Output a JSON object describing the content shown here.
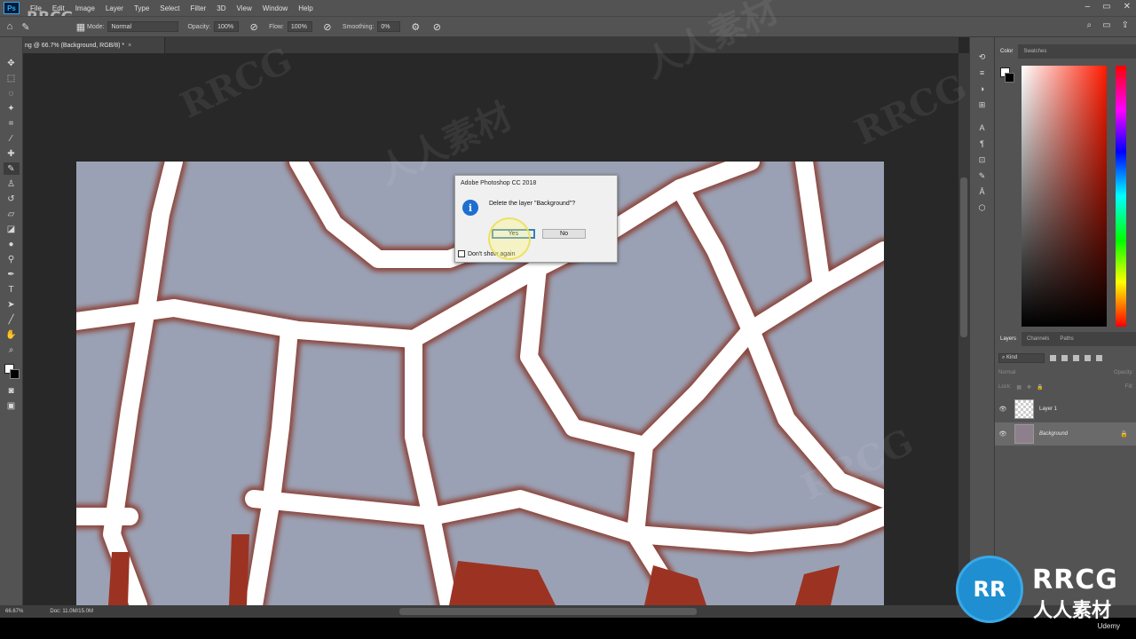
{
  "app": {
    "logo_text": "Ps",
    "menu": [
      "File",
      "Edit",
      "Image",
      "Layer",
      "Type",
      "Select",
      "Filter",
      "3D",
      "View",
      "Window",
      "Help"
    ],
    "window_controls": [
      "–",
      "▭",
      "✕"
    ]
  },
  "options_bar": {
    "mode_label": "Mode:",
    "mode_value": "Normal",
    "opacity_label": "Opacity:",
    "opacity_value": "100%",
    "flow_label": "Flow:",
    "flow_value": "100%",
    "smoothing_label": "Smoothing:",
    "smoothing_value": "0%"
  },
  "document": {
    "tab_title": "ng @ 66.7% (Background, RGB/8) *",
    "close_glyph": "×"
  },
  "dialog": {
    "title": "Adobe Photoshop CC 2018",
    "info_glyph": "i",
    "message": "Delete the layer \"Background\"?",
    "yes_label": "Yes",
    "no_label": "No",
    "dont_show_label": "Don't show again"
  },
  "color_panel": {
    "tabs": [
      "Color",
      "Swatches"
    ],
    "foreground_color": "#ffffff",
    "background_color": "#000000"
  },
  "layers_panel": {
    "tabs": [
      "Layers",
      "Channels",
      "Paths"
    ],
    "kind_label": "Kind",
    "blend_mode": "Normal",
    "opacity_text": "Opacity:",
    "lock_label": "Lock:",
    "fill_text": "Fill:",
    "layers": [
      {
        "name": "Layer 1",
        "visible": true,
        "thumb": "transparent"
      },
      {
        "name": "Background",
        "visible": true,
        "thumb": "stone",
        "locked": true,
        "selected": true
      }
    ]
  },
  "status_bar": {
    "zoom": "66.67%",
    "doc_info": "Doc: 11.0M/15.0M"
  },
  "watermark": {
    "corner": "RRCG",
    "logo_letters": "RR",
    "brand": "RRCG",
    "brand_cn": "人人素材",
    "faint": [
      "RRCG",
      "人人素材",
      "RRCG",
      "人人素材",
      "RRCG"
    ]
  },
  "footer": {
    "udemy": "Udemy"
  }
}
